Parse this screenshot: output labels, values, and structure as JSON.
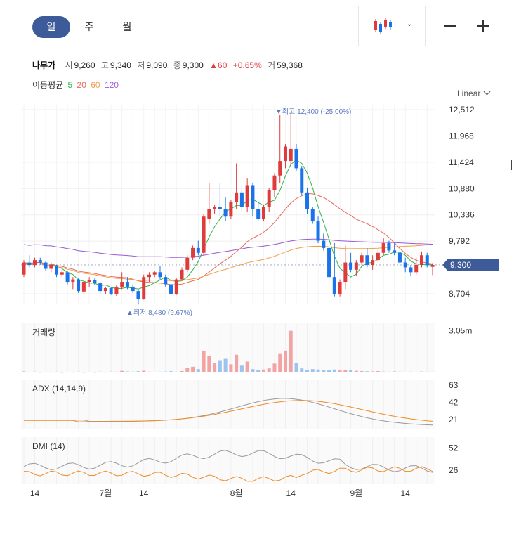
{
  "toolbar": {
    "periods": [
      "일",
      "주",
      "월"
    ],
    "active_period": "일"
  },
  "quote": {
    "name": "나무가",
    "open_label": "시",
    "open": "9,260",
    "high_label": "고",
    "high": "9,340",
    "low_label": "저",
    "low": "9,090",
    "close_label": "종",
    "close": "9,300",
    "change": "▲60",
    "change_pct": "+0.65%",
    "volume_label": "거",
    "volume": "59,368"
  },
  "ma": {
    "label": "이동평균",
    "periods": [
      {
        "value": "5",
        "color": "#32b34a"
      },
      {
        "value": "20",
        "color": "#e86a5a"
      },
      {
        "value": "60",
        "color": "#f0a04b"
      },
      {
        "value": "120",
        "color": "#9b59d6"
      }
    ]
  },
  "scale": {
    "label": "Linear"
  },
  "colors": {
    "up": "#e03b3b",
    "down": "#1a73e8",
    "up_light": "#f2a3a3",
    "down_light": "#9cc4ef",
    "price_tag": "#3d5a99",
    "adx": "#999999",
    "di": "#f08a24"
  },
  "chart_data": [
    {
      "type": "candlestick",
      "title": "",
      "yticks": [
        "12,512",
        "11,968",
        "11,424",
        "10,880",
        "10,336",
        "9,792",
        "8,704"
      ],
      "ylim": [
        8500,
        12600
      ],
      "current_price": "9,300",
      "annotations": [
        {
          "text": "▼최고 12,400 (-25.00%)",
          "value": 12400
        },
        {
          "text": "▲최저 8,480 (9.67%)",
          "value": 8480
        }
      ],
      "ohlc": [
        [
          9100,
          9400,
          9050,
          9350
        ],
        [
          9350,
          9500,
          9250,
          9300
        ],
        [
          9300,
          9450,
          9250,
          9400
        ],
        [
          9400,
          9450,
          9300,
          9350
        ],
        [
          9350,
          9380,
          9180,
          9220
        ],
        [
          9220,
          9350,
          9150,
          9300
        ],
        [
          9280,
          9300,
          9050,
          9100
        ],
        [
          9100,
          9200,
          9050,
          9150
        ],
        [
          9150,
          9180,
          8900,
          8950
        ],
        [
          8950,
          9050,
          8800,
          9000
        ],
        [
          9000,
          9020,
          8720,
          8760
        ],
        [
          8750,
          9000,
          8700,
          8950
        ],
        [
          8950,
          9050,
          8850,
          8980
        ],
        [
          8980,
          9020,
          8880,
          8920
        ],
        [
          8920,
          8950,
          8700,
          8760
        ],
        [
          8760,
          8850,
          8700,
          8820
        ],
        [
          8820,
          8850,
          8680,
          8700
        ],
        [
          8700,
          8880,
          8660,
          8850
        ],
        [
          8850,
          9150,
          8800,
          8950
        ],
        [
          8950,
          9050,
          8800,
          8850
        ],
        [
          8850,
          8900,
          8720,
          8760
        ],
        [
          8760,
          8780,
          8480,
          8600
        ],
        [
          8600,
          9100,
          8580,
          9050
        ],
        [
          9050,
          9150,
          8950,
          9100
        ],
        [
          9100,
          9180,
          9050,
          9150
        ],
        [
          9150,
          9280,
          9000,
          9050
        ],
        [
          9050,
          9100,
          8850,
          8900
        ],
        [
          8900,
          8950,
          8650,
          8700
        ],
        [
          8700,
          9020,
          8680,
          9000
        ],
        [
          9000,
          9250,
          8980,
          9200
        ],
        [
          9200,
          9500,
          9150,
          9450
        ],
        [
          9450,
          9700,
          9400,
          9650
        ],
        [
          9650,
          9800,
          9500,
          9550
        ],
        [
          9550,
          10350,
          9500,
          10300
        ],
        [
          10250,
          11000,
          10150,
          10450
        ],
        [
          10450,
          10550,
          10350,
          10500
        ],
        [
          10500,
          11000,
          10300,
          10450
        ],
        [
          10450,
          10700,
          10200,
          10300
        ],
        [
          10300,
          10650,
          10250,
          10600
        ],
        [
          10600,
          11400,
          10450,
          10800
        ],
        [
          10800,
          10950,
          10400,
          10500
        ],
        [
          10500,
          11100,
          10400,
          10950
        ],
        [
          10950,
          11000,
          10300,
          10450
        ],
        [
          10450,
          10600,
          10200,
          10250
        ],
        [
          10250,
          10550,
          10200,
          10500
        ],
        [
          10500,
          10900,
          10400,
          10850
        ],
        [
          10850,
          11200,
          10700,
          11150
        ],
        [
          11150,
          12400,
          11000,
          11450
        ],
        [
          11450,
          11800,
          11300,
          11750
        ],
        [
          11450,
          12450,
          11350,
          11700
        ],
        [
          11700,
          11800,
          11250,
          11300
        ],
        [
          11300,
          11350,
          10750,
          10800
        ],
        [
          10800,
          10900,
          10350,
          10450
        ],
        [
          10450,
          10500,
          10150,
          10200
        ],
        [
          10200,
          10300,
          9750,
          9800
        ],
        [
          9800,
          9950,
          9600,
          9650
        ],
        [
          9650,
          9800,
          8950,
          9050
        ],
        [
          9050,
          9750,
          8650,
          8700
        ],
        [
          8700,
          9000,
          8650,
          8950
        ],
        [
          8950,
          9700,
          8800,
          9350
        ],
        [
          9350,
          9550,
          9150,
          9200
        ],
        [
          9200,
          9400,
          9080,
          9350
        ],
        [
          9350,
          9550,
          9300,
          9500
        ],
        [
          9500,
          9650,
          9250,
          9300
        ],
        [
          9300,
          9500,
          9200,
          9400
        ],
        [
          9400,
          9600,
          9350,
          9550
        ],
        [
          9550,
          9850,
          9500,
          9750
        ],
        [
          9750,
          9800,
          9550,
          9600
        ],
        [
          9600,
          9750,
          9500,
          9550
        ],
        [
          9550,
          9620,
          9300,
          9350
        ],
        [
          9350,
          9450,
          9150,
          9250
        ],
        [
          9250,
          9300,
          9080,
          9150
        ],
        [
          9150,
          9450,
          9100,
          9300
        ],
        [
          9300,
          9580,
          9250,
          9500
        ],
        [
          9500,
          9550,
          9250,
          9300
        ],
        [
          9260,
          9340,
          9090,
          9300
        ]
      ]
    },
    {
      "type": "bar",
      "title": "거래량",
      "yticks": [
        "3.05m"
      ],
      "ymax": 3600000,
      "values": [
        80000,
        50000,
        60000,
        40000,
        50000,
        45000,
        60000,
        40000,
        50000,
        45000,
        60000,
        40000,
        50000,
        40000,
        60000,
        45000,
        70000,
        60000,
        120000,
        80000,
        60000,
        90000,
        130000,
        60000,
        50000,
        60000,
        70000,
        90000,
        60000,
        110000,
        350000,
        420000,
        250000,
        1600000,
        1200000,
        700000,
        900000,
        1000000,
        600000,
        1300000,
        500000,
        800000,
        250000,
        200000,
        220000,
        300000,
        650000,
        1400000,
        1600000,
        3050000,
        700000,
        300000,
        200000,
        250000,
        220000,
        200000,
        180000,
        220000,
        150000,
        180000,
        200000,
        120000,
        100000,
        90000,
        80000,
        100000,
        70000,
        60000,
        80000,
        60000,
        50000,
        60000,
        50000,
        70000,
        60000,
        59368
      ]
    },
    {
      "type": "line",
      "title": "ADX (14,14,9)",
      "yticks": [
        "63",
        "42",
        "21"
      ],
      "ylim": [
        10,
        70
      ]
    },
    {
      "type": "line",
      "title": "DMI (14)",
      "yticks": [
        "52",
        "26"
      ],
      "ylim": [
        10,
        65
      ]
    }
  ],
  "x_axis": {
    "ticks": [
      {
        "label": "14",
        "index": 2
      },
      {
        "label": "7월",
        "index": 15
      },
      {
        "label": "14",
        "index": 22
      },
      {
        "label": "8월",
        "index": 39
      },
      {
        "label": "14",
        "index": 49
      },
      {
        "label": "9월",
        "index": 61
      },
      {
        "label": "14",
        "index": 70
      }
    ]
  }
}
